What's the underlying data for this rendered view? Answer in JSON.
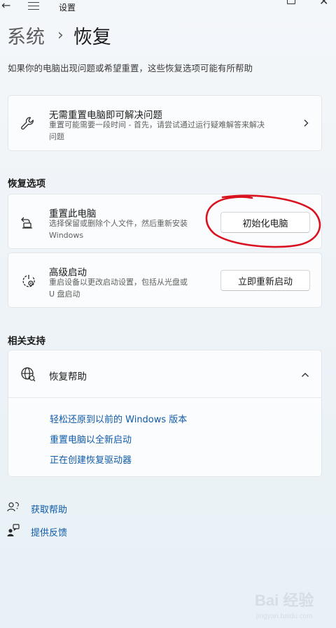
{
  "window": {
    "title": "设置"
  },
  "breadcrumb": {
    "parent": "系统",
    "separator": "›",
    "current": "恢复"
  },
  "description": "如果你的电脑出现问题或希望重置，这些恢复选项可能有所帮助",
  "troubleshoot_card": {
    "title": "无需重置电脑即可解决问题",
    "subtitle_line1": "重置可能需要一段时间 - 首先，请尝试通过运行疑难解答来解决",
    "subtitle_line2": "问题"
  },
  "recovery_options": {
    "heading": "恢复选项",
    "reset": {
      "title": "重置此电脑",
      "subtitle_line1": "选择保留或删除个人文件，然后重新安装",
      "subtitle_line2": "Windows",
      "button_label": "初始化电脑"
    },
    "advanced": {
      "title": "高级启动",
      "subtitle_line1": "重启设备以更改启动设置，包括从光盘或",
      "subtitle_line2": "U 盘启动",
      "button_label": "立即重新启动"
    }
  },
  "related_support": {
    "heading": "相关支持",
    "help": {
      "title": "恢复帮助",
      "links": [
        "轻松还原到以前的 Windows 版本",
        "重置电脑以全新启动",
        "正在创建恢复驱动器"
      ]
    }
  },
  "footer": {
    "get_help": "获取帮助",
    "feedback": "提供反馈"
  },
  "watermark": {
    "text": "Bai 经验",
    "url": "jingyan.baidu.com"
  },
  "colors": {
    "accent_link": "#0f5aa8",
    "annotation_red": "#d8121e"
  }
}
